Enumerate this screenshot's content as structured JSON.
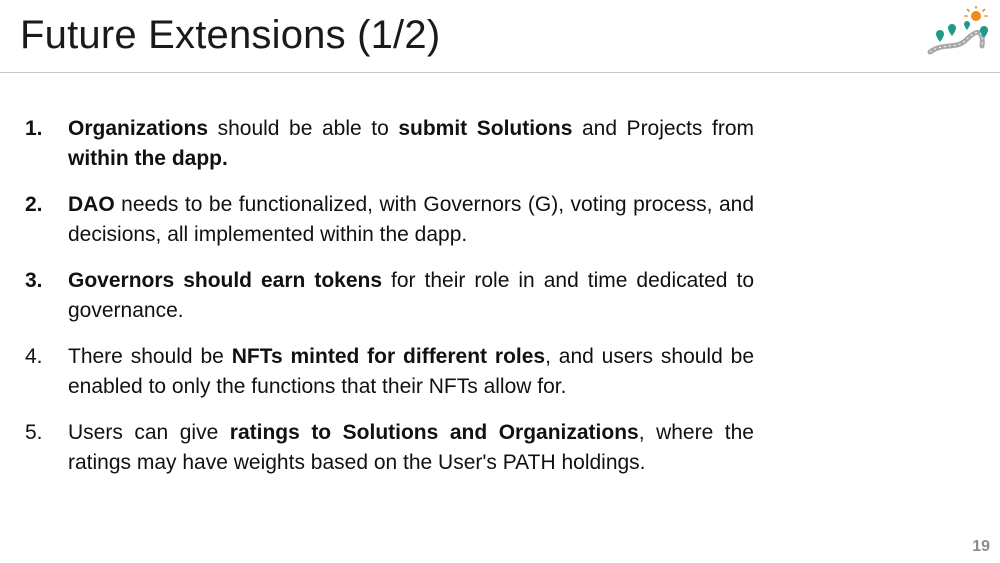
{
  "slide": {
    "title": "Future Extensions (1/2)",
    "page_number": "19"
  },
  "items": [
    {
      "number": "1.",
      "parts": [
        "Organizations",
        " should be able to ",
        "submit Solutions",
        " and Projects from ",
        "within the dapp."
      ]
    },
    {
      "number": "2.",
      "parts": [
        "DAO",
        " needs to be functionalized, with Governors (G), voting process, and decisions, all implemented within the dapp."
      ]
    },
    {
      "number": "3.",
      "parts": [
        "Governors should earn tokens",
        " for their role in and time dedicated to governance."
      ]
    },
    {
      "number": "4.",
      "parts": [
        "There should be ",
        "NFTs minted for different roles",
        ", and users should be enabled to only the functions that their NFTs allow for."
      ]
    },
    {
      "number": "5.",
      "parts": [
        "Users can give ",
        "ratings to Solutions and Organizations",
        ", where the ratings may have weights based on the User's PATH holdings."
      ]
    }
  ],
  "logo": {
    "icon": "path-roadmap-logo-icon",
    "colors": {
      "sun": "#f08a1c",
      "pins": "#1f9a8a",
      "road": "#9a9a9a"
    }
  }
}
